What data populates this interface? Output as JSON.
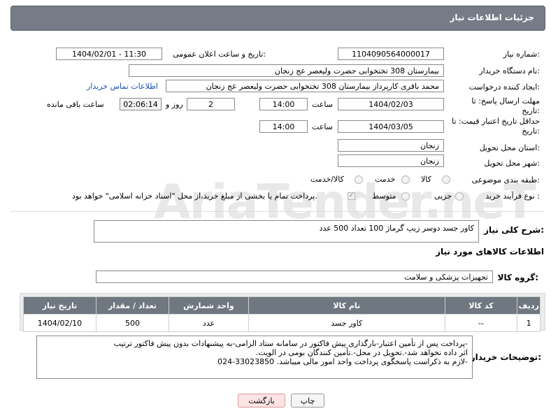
{
  "header": {
    "title": "جزئیات اطلاعات نیاز"
  },
  "form": {
    "need_number_label": "شماره نیاز:",
    "need_number": "1104090564000017",
    "announce_label": "تاریخ و ساعت اعلان عمومی:",
    "announce_value": "1404/02/01 - 11:30",
    "buyer_org_label": "نام دستگاه خریدار:",
    "buyer_org": "بیمارستان 308 تختخوابی حضرت ولیعصر عج  زنجان",
    "creator_label": "ایجاد کننده درخواست:",
    "creator": "محمد باقری کارپرداز بیمارستان 308 تختخوابی حضرت ولیعصر عج  زنجان",
    "contact_link": "اطلاعات تماس خریدار",
    "deadline_label": "مهلت ارسال پاسخ: تا تاریخ:",
    "deadline_date": "1404/02/03",
    "time_label": "ساعت",
    "deadline_time": "14:00",
    "days_value": "2",
    "days_label": "روز و",
    "remaining_time": "02:06:14",
    "remaining_label": "ساعت باقی مانده",
    "validity_label": "حداقل تاریخ اعتبار قیمت: تا تاریخ:",
    "validity_date": "1404/03/05",
    "validity_time": "14:00",
    "province_label": "استان محل تحویل:",
    "province": "زنجان",
    "city_label": "شهر محل تحویل:",
    "city": "زنجان",
    "category_label": "طبقه بندی موضوعی:",
    "category_options": [
      "کالا",
      "خدمت",
      "کالا/خدمت"
    ],
    "process_label": "نوع فرآیند خرید :",
    "process_options": [
      "جزیی",
      "متوسط"
    ],
    "payment_note": "پرداخت تمام یا بخشی از مبلغ خرید،از محل \"اسناد خزانه اسلامی\" خواهد بود."
  },
  "description": {
    "label": "شرح کلی نیاز:",
    "value": "کاور جسد دوسر زیپ گرماژ 100 تعداد 500 عدد"
  },
  "goods": {
    "section_title": "اطلاعات کالاهای مورد نیاز",
    "group_label": "گروه کالا:",
    "group_value": "تجهیزات پزشکی و سلامت",
    "columns": [
      "ردیف",
      "کد کالا",
      "نام کالا",
      "واحد شمارش",
      "تعداد / مقدار",
      "تاریخ نیاز"
    ],
    "rows": [
      [
        "1",
        "--",
        "کاور جسد",
        "عدد",
        "500",
        "1404/02/10"
      ]
    ]
  },
  "buyer_notes": {
    "label": "توضیحات خریدار:",
    "lines": [
      "-پرداخت پس از تأمین اعتبار-بارگذاری پیش فاکتور در سامانه ستاد الزامی-به پیشنهادات بدون پیش فاکتور ترتیب",
      "اثر داده نخواهد شد-.تحویل در محل-.تأمین کنندگان بومی در الویت.",
      "-لازم به ذکراست پاسخگوی پرداخت واحد امور مالی میباشد. 33023850-024"
    ]
  },
  "buttons": {
    "print": "چاپ",
    "back": "بازگشت"
  },
  "watermark": "AriaTender.neT",
  "colors": {
    "header_bg": "#757c87",
    "table_header_bg": "#6f7780",
    "link": "#1a4fb3",
    "back_button_bg": "#fde4e4"
  }
}
